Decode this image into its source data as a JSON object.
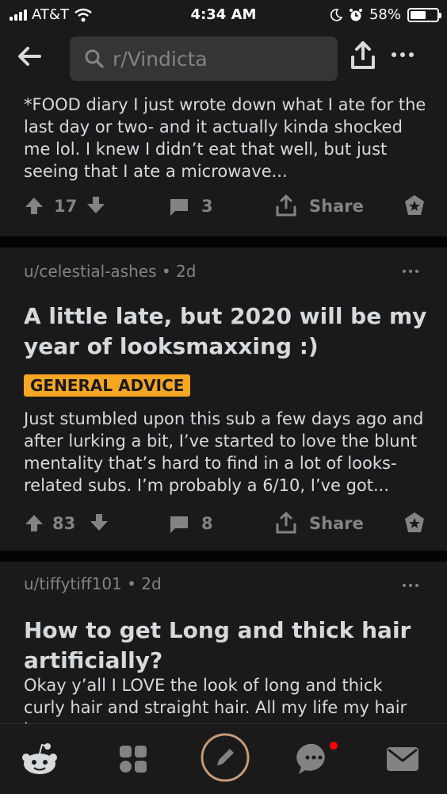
{
  "status_bar": {
    "carrier": "AT&T",
    "time": "4:34 AM",
    "battery": "58%",
    "battery_level": 0.58
  },
  "header": {
    "search_text": "r/Vindicta",
    "icons": [
      "back-arrow-icon",
      "search-icon",
      "share-icon",
      "more-icon"
    ]
  },
  "posts": [
    {
      "body": "*FOOD diary  I just wrote down what I ate for the last day or two- and it actually kinda shocked me lol. I knew I didn’t eat that well, but just seeing that I ate a microwave...",
      "votes": "17",
      "comments": "3",
      "share_label": "Share"
    },
    {
      "author": "u/celestial-ashes",
      "age": "2d",
      "title": "A little late, but 2020 will be my year of looksmaxxing :)",
      "flair": "GENERAL ADVICE",
      "body": "Just stumbled upon this sub a few days ago and after lurking a bit, I’ve started to love the blunt mentality that’s hard to find in a lot of looks-related subs.  I’m probably a 6/10, I’ve got...",
      "votes": "83",
      "comments": "8",
      "share_label": "Share"
    },
    {
      "author": "u/tiffytiff101",
      "age": "2d",
      "title": "How to get Long and thick hair artificially?",
      "body": "Okay y’all I LOVE the look of long and thick curly hair and straight hair. All my life my hair has"
    }
  ],
  "bottom_nav": {
    "items": [
      "reddit-home-icon",
      "communities-icon",
      "create-post-icon",
      "chat-icon",
      "inbox-icon"
    ],
    "notification_color": "#ff0000"
  },
  "colors": {
    "background": "#1a1a1b",
    "separator": "#030303",
    "text": "#d7dadc",
    "muted": "#818384",
    "flair": "#f5a623"
  }
}
